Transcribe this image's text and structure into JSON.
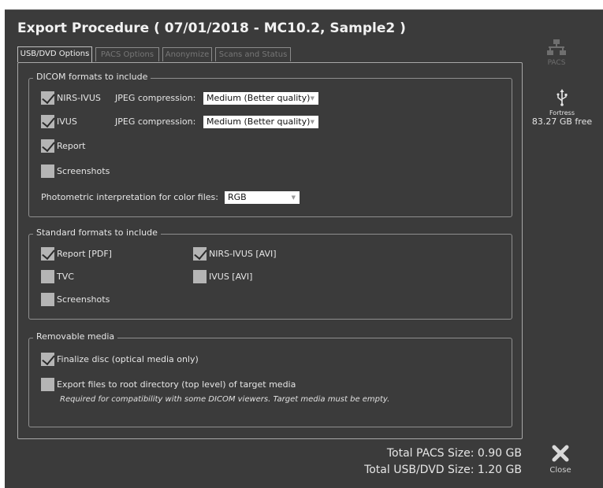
{
  "dialog": {
    "title": "Export Procedure  ( 07/01/2018 - MC10.2, Sample2 )"
  },
  "tabs": [
    {
      "label": "USB/DVD Options",
      "active": true
    },
    {
      "label": "PACS Options",
      "active": false
    },
    {
      "label": "Anonymize",
      "active": false
    },
    {
      "label": "Scans and Status",
      "active": false
    }
  ],
  "dicom": {
    "label": "DICOM formats to include",
    "nirs_ivus": {
      "label": "NIRS-IVUS",
      "checked": true,
      "jpeg_label": "JPEG compression:",
      "jpeg_value": "Medium (Better quality)"
    },
    "ivus": {
      "label": "IVUS",
      "checked": true,
      "jpeg_label": "JPEG compression:",
      "jpeg_value": "Medium (Better quality)"
    },
    "report": {
      "label": "Report",
      "checked": true
    },
    "screenshots": {
      "label": "Screenshots",
      "checked": false
    },
    "photometric_label": "Photometric interpretation for color files:",
    "photometric_value": "RGB"
  },
  "standard": {
    "label": "Standard formats to include",
    "report_pdf": {
      "label": "Report [PDF]",
      "checked": true
    },
    "tvc": {
      "label": "TVC",
      "checked": false
    },
    "screenshots": {
      "label": "Screenshots",
      "checked": false
    },
    "nirs_ivus_avi": {
      "label": "NIRS-IVUS [AVI]",
      "checked": true
    },
    "ivus_avi": {
      "label": "IVUS [AVI]",
      "checked": false
    }
  },
  "removable": {
    "label": "Removable media",
    "finalize": {
      "label": "Finalize disc (optical media only)",
      "checked": true
    },
    "root_dir": {
      "label": "Export files to root directory (top level) of target media",
      "checked": false
    },
    "note": "Required for compatibility with some DICOM viewers. Target media must be empty."
  },
  "side": {
    "pacs_label": "PACS",
    "usb_name": "Fortress",
    "usb_free": "83.27 GB free",
    "close_label": "Close"
  },
  "totals": {
    "pacs": "Total PACS Size: 0.90 GB",
    "usb": "Total USB/DVD Size: 1.20 GB"
  },
  "colors": {
    "background": "#3b3b3b",
    "text": "#e6e6e6",
    "checkbox": "#b5b5b5"
  }
}
